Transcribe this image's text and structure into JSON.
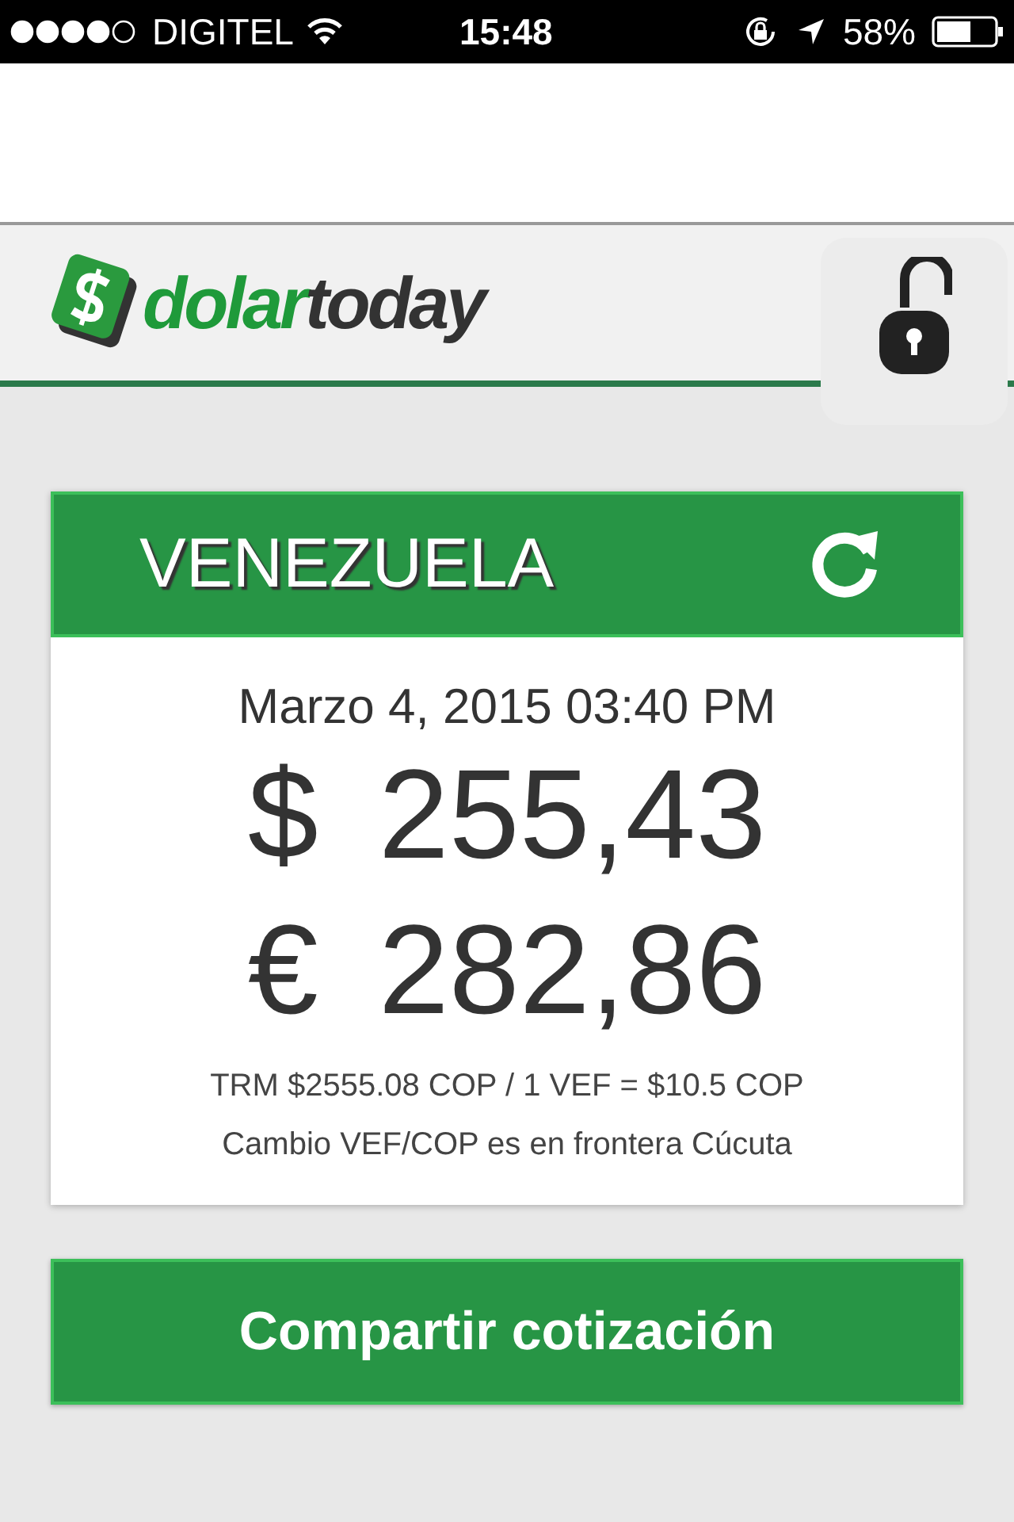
{
  "status_bar": {
    "carrier": "DIGITEL",
    "time": "15:48",
    "battery": "58%"
  },
  "header": {
    "logo": {
      "parts": [
        "dolar",
        "today"
      ]
    },
    "locked": false
  },
  "card": {
    "country": "VENEZUELA",
    "date": "Marzo 4, 2015 03:40 PM",
    "rates": [
      {
        "symbol": "$",
        "value": "255,43"
      },
      {
        "symbol": "€",
        "value": "282,86"
      }
    ],
    "notes": [
      "TRM $2555.08 COP / 1 VEF = $10.5 COP",
      "Cambio VEF/COP es en frontera Cúcuta"
    ]
  },
  "share_button": "Compartir cotización"
}
